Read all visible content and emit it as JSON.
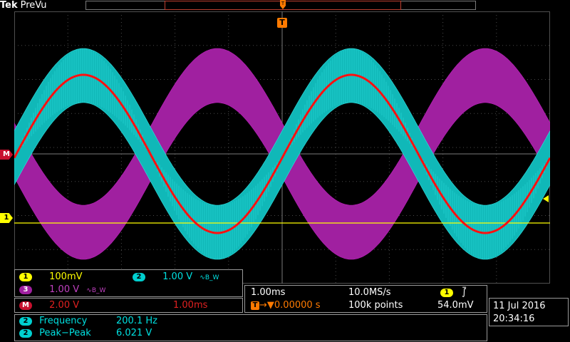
{
  "header": {
    "brand": "Tek",
    "mode": "PreVu"
  },
  "trigger_marker": {
    "label": "T"
  },
  "channel_markers": {
    "math": "M",
    "ch1": "1"
  },
  "vertical": {
    "ch1": {
      "id": "1",
      "scale": "100mV"
    },
    "ch2": {
      "id": "2",
      "scale": "1.00 V",
      "bw": "B_W"
    },
    "ch3": {
      "id": "3",
      "scale": "1.00 V",
      "bw": "B_W"
    },
    "math": {
      "id": "M",
      "scale": "2.00 V",
      "time": "1.00ms"
    }
  },
  "horizontal": {
    "scale": "1.00ms",
    "sample_rate": "10.0MS/s",
    "trigger_position": "0.00000 s",
    "record_length": "100k points",
    "trigger_source": "1",
    "trigger_level": "54.0mV"
  },
  "measurements": [
    {
      "channel": "2",
      "name": "Frequency",
      "value": "200.1 Hz"
    },
    {
      "channel": "2",
      "name": "Peak−Peak",
      "value": "6.021 V"
    }
  ],
  "datetime": {
    "date": "11 Jul  2016",
    "time": "20:34:16"
  },
  "colors": {
    "ch1": "#ffff00",
    "ch2": "#00d0d0",
    "ch3": "#a020a0",
    "math": "#e01010",
    "trigger": "#ff7a00"
  }
}
